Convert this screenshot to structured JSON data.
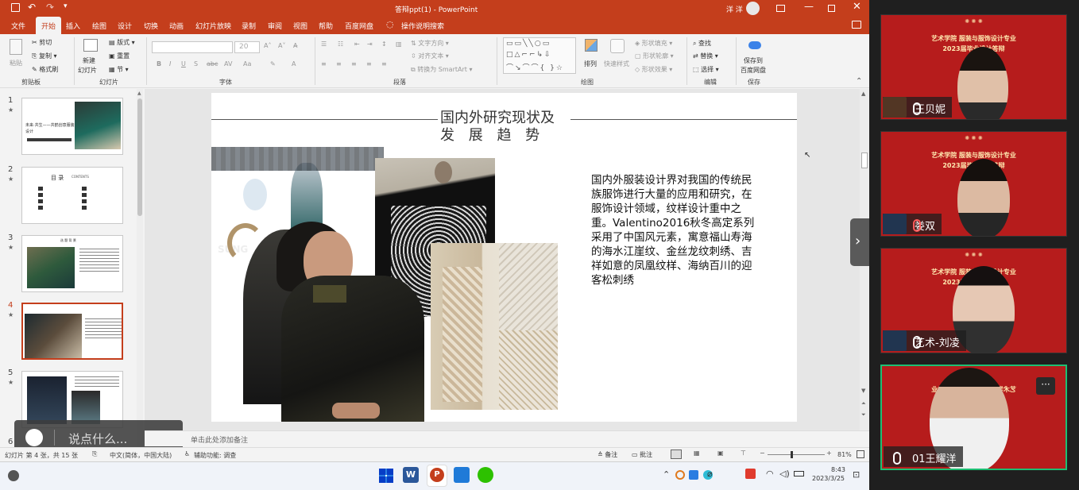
{
  "titlebar": {
    "doc_title": "答辩ppt(1)",
    "separator": "-",
    "app_name": "PowerPoint",
    "user_name": "洋 洋"
  },
  "tabs": [
    "文件",
    "开始",
    "插入",
    "绘图",
    "设计",
    "切换",
    "动画",
    "幻灯片放映",
    "录制",
    "审阅",
    "视图",
    "帮助",
    "百度网盘",
    "操作说明搜索"
  ],
  "ribbon": {
    "clipboard": {
      "paste": "粘贴",
      "cut": "剪切",
      "copy": "复制",
      "format_painter": "格式刷",
      "group": "剪贴板"
    },
    "slides": {
      "new_slide_1": "新建",
      "new_slide_2": "幻灯片",
      "layout": "版式",
      "reset": "重置",
      "section": "节",
      "group": "幻灯片"
    },
    "font": {
      "size": "20",
      "group": "字体"
    },
    "paragraph": {
      "text_direction": "文字方向",
      "align_text": "对齐文本",
      "smartart": "转换为 SmartArt",
      "group": "段落"
    },
    "drawing": {
      "arrange": "排列",
      "quick_styles": "快速样式",
      "shape_fill": "形状填充",
      "shape_outline": "形状轮廓",
      "shape_effects": "形状效果",
      "group": "绘图"
    },
    "editing": {
      "find": "查找",
      "replace": "替换",
      "select": "选择",
      "group": "编辑"
    },
    "save": {
      "label_1": "保存到",
      "label_2": "百度网盘",
      "group": "保存"
    }
  },
  "thumbs": [
    {
      "num": "1",
      "star": "★",
      "caption": "未来·共生——共鹤创意服装设计"
    },
    {
      "num": "2",
      "star": "★",
      "title": "目 录",
      "sub": "CONTENTS"
    },
    {
      "num": "3",
      "star": "★",
      "title": "选 题 背 景"
    },
    {
      "num": "4",
      "star": "★"
    },
    {
      "num": "5",
      "star": "★"
    },
    {
      "num": "6"
    }
  ],
  "slide": {
    "title_line1": "国内外研究现状及",
    "title_line2": "发 展 趋 势",
    "body": "国内外服装设计界对我国的传统民族服饰进行大量的应用和研究，在服饰设计领域，纹样设计重中之重。Valentino2016秋冬高定系列采用了中国风元素，寓意福山寿海的海水江崖纹、金丝龙纹刺绣、吉祥如意的凤凰纹样、海纳百川的迎客松刺绣",
    "runway_text": "SUNG"
  },
  "notes": {
    "placeholder": "单击此处添加备注"
  },
  "chat": {
    "placeholder": "说点什么..."
  },
  "status": {
    "slide_info": "幻灯片 第 4 张，共 15 张",
    "language": "中文(简体，中国大陆)",
    "accessibility": "辅助功能: 调查",
    "notes_btn": "备注",
    "comments_btn": "批注",
    "zoom": "81%",
    "zoom_level": 0.81
  },
  "taskbar": {
    "time": "8:43",
    "date": "2023/3/25"
  },
  "participants": [
    {
      "name": "王贝妮",
      "banner1": "艺术学院 服装与服饰设计专业",
      "banner2": "2023届毕业设计答辩",
      "muted": false,
      "badge": "#f0803a"
    },
    {
      "name": "娄双",
      "banner1": "艺术学院 服装与服饰设计专业",
      "banner2": "2023届毕业设计答辩",
      "muted": true,
      "badge": "#2f7be8"
    },
    {
      "name": "艺术-刘凌",
      "banner1": "艺术学院 服装与服饰设计专业",
      "banner2": "2023届毕业设计答辩",
      "muted": false,
      "badge": "#2f7be8"
    },
    {
      "name": "01王耀洋",
      "banner1": "艺术学院 服装与服饰设计专业",
      "banner2": "2023届毕业设计答辩",
      "muted": false,
      "badge": "#2f7be8"
    }
  ],
  "colors": {
    "brand": "#c43e1c",
    "tile_bg": "#b61c1c",
    "active_border": "#1dbf73"
  }
}
